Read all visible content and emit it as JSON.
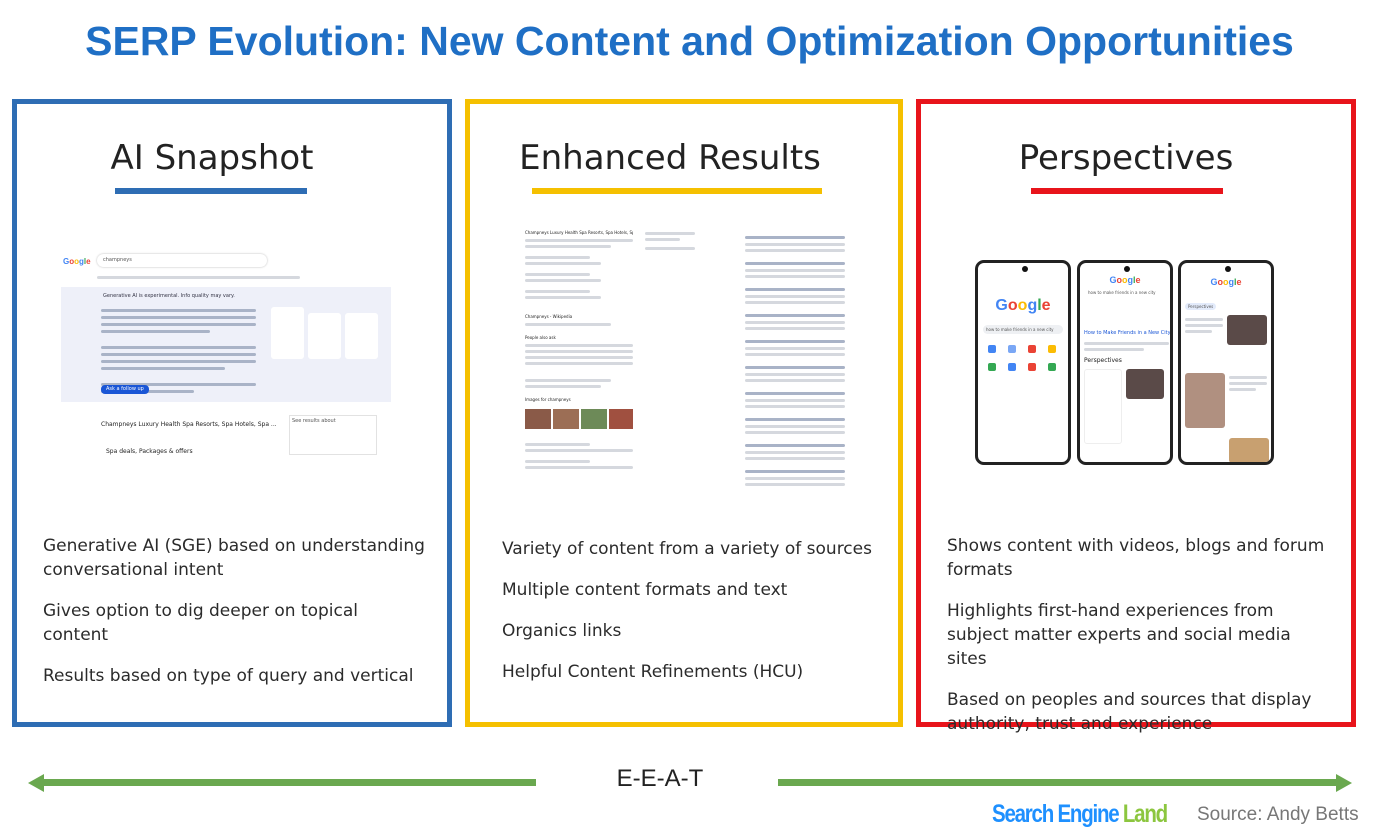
{
  "title": "SERP Evolution: New Content and Optimization Opportunities",
  "colors": {
    "title": "#1f6fc5",
    "ai_snapshot": "#2e6db4",
    "enhanced_results": "#f5c000",
    "perspectives": "#e8141b",
    "arrow": "#6aa84f"
  },
  "panels": [
    {
      "heading": "AI Snapshot",
      "bullets": [
        "Generative AI (SGE) based on understanding conversational  intent",
        "Gives option to dig deeper on topical content",
        "Results based on type of query and vertical"
      ]
    },
    {
      "heading": "Enhanced Results",
      "bullets": [
        "Variety of content from a variety of sources",
        "Multiple content formats and text",
        "Organics links",
        "Helpful Content Refinements (HCU)"
      ]
    },
    {
      "heading": "Perspectives",
      "bullets": [
        "Shows content with videos, blogs and forum formats",
        "Highlights first-hand experiences from subject matter experts and social media sites",
        "Based on peoples and sources that display authority, trust and experience"
      ]
    }
  ],
  "ai_shot": {
    "query": "champneys",
    "sge_label": "Generative AI is experimental. Info quality may vary.",
    "follow_up": "Ask a follow up",
    "result_title": "Champneys Luxury Health Spa Resorts, Spa Hotels, Spa ...",
    "sublink": "Spa deals, Packages & offers",
    "see_results": "See results about"
  },
  "enhanced_shot": {
    "result_title": "Champneys Luxury Health Spa Resorts, Spa Hotels, Spa ...",
    "wiki": "Champneys - Wikipedia",
    "paa": "People also ask",
    "images": "Images for champneys"
  },
  "perspectives_shot": {
    "query": "how to make friends in a new city",
    "result_title": "How to Make Friends in a New City",
    "section": "Perspectives",
    "chip": "Perspectives"
  },
  "arrow_label": "E-E-A-T",
  "logo": {
    "part1": "Search Engine",
    "part2": "Land"
  },
  "source": "Source: Andy Betts"
}
